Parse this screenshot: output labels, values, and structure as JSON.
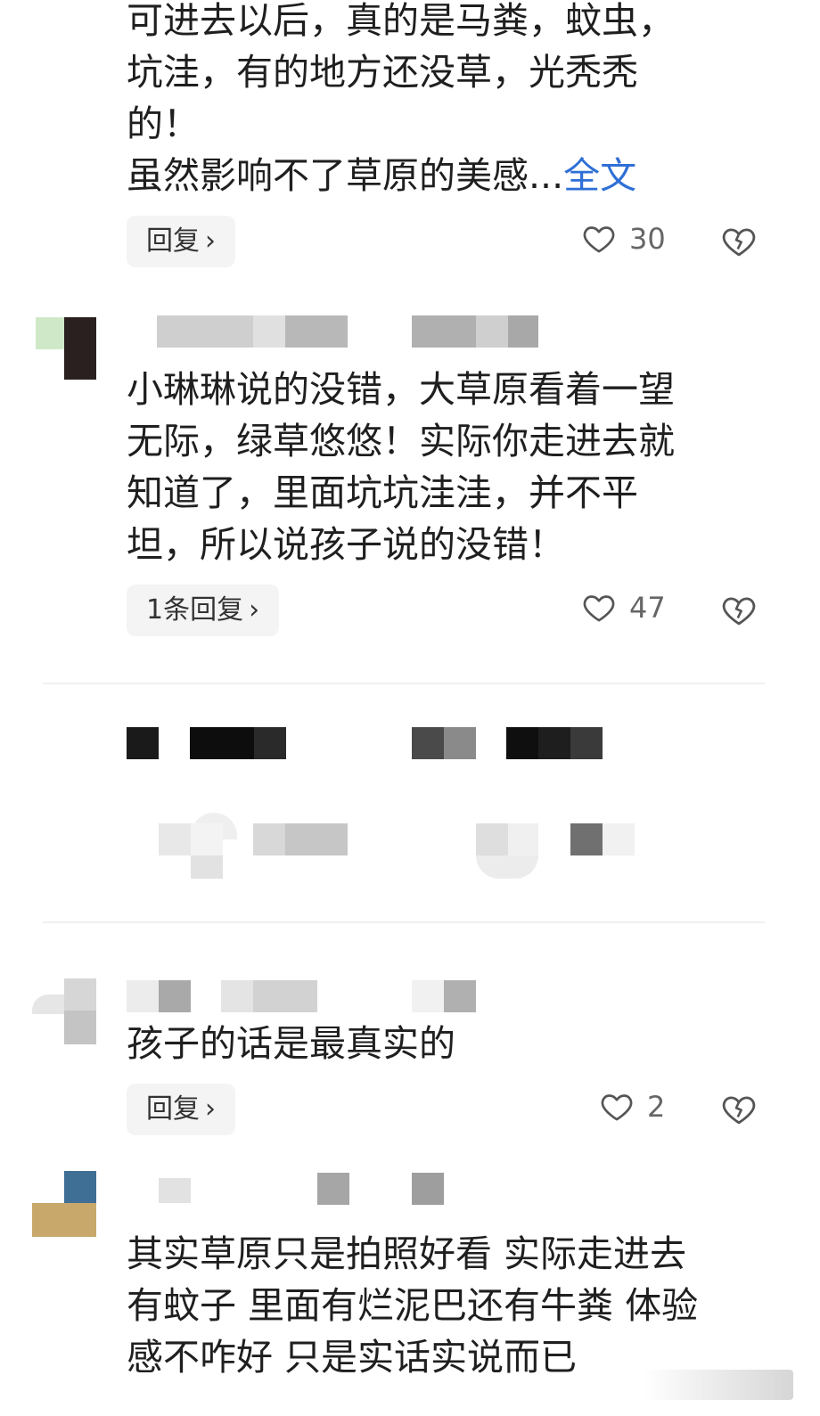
{
  "comment1": {
    "lines": [
      "可进去以后，真的是马粪，蚊虫，",
      "坑洼，有的地方还没草，光秃秃",
      "的！"
    ],
    "last_line": "虽然影响不了草原的美感...",
    "more_label": "全文",
    "reply_label": "回复",
    "likes": "30"
  },
  "comment2": {
    "lines": [
      "小琳琳说的没错，大草原看着一望",
      "无际，绿草悠悠！实际你走进去就",
      "知道了，里面坑坑洼洼，并不平",
      "坦，所以说孩子说的没错！"
    ],
    "reply_label": "1条回复",
    "likes": "47"
  },
  "comment3": {
    "lines": [
      "孩子的话是最真实的"
    ],
    "reply_label": "回复",
    "likes": "2"
  },
  "comment4": {
    "lines": [
      "其实草原只是拍照好看 实际走进去",
      "有蚊子 里面有烂泥巴还有牛粪 体验",
      "感不咋好 只是实话实说而已"
    ]
  },
  "icons": {
    "like": "heart-outline-icon",
    "dislike": "broken-heart-icon",
    "chevron": "chevron-right-icon"
  },
  "colors": {
    "link": "#2f6fd6",
    "text": "#1f1f1f",
    "count": "#666666",
    "reply_bg": "#f4f4f4"
  }
}
